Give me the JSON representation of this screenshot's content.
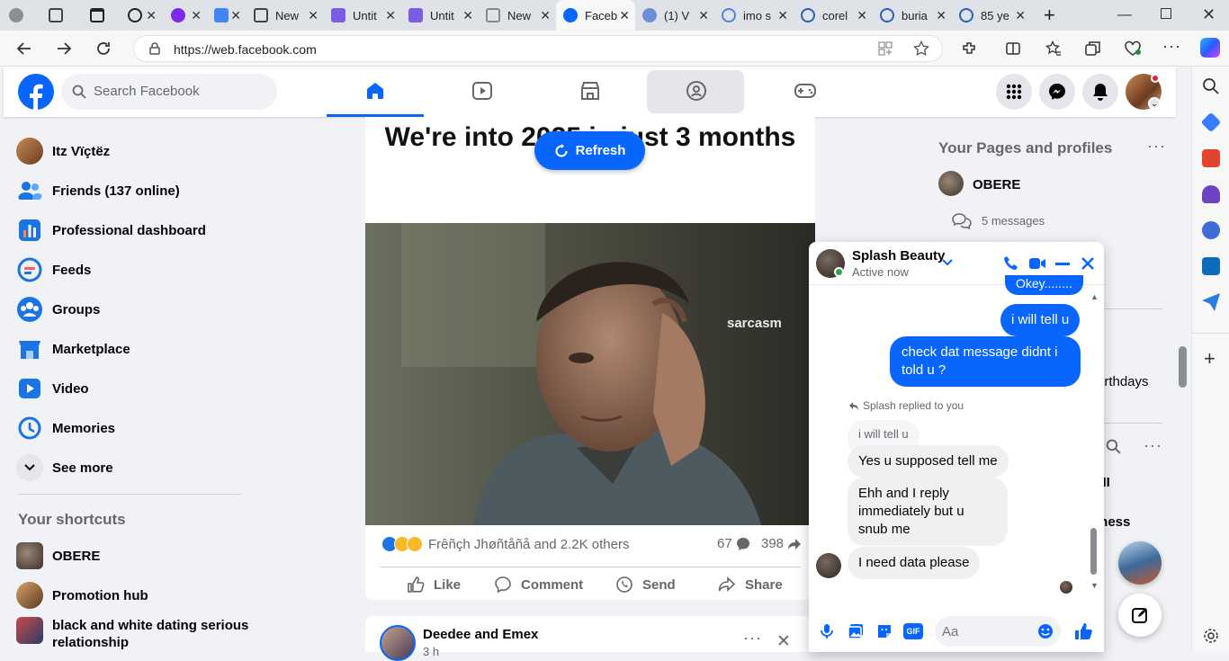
{
  "browser": {
    "tabs": [
      {
        "title": "",
        "favicon": "profile-icon",
        "color": "#888888"
      },
      {
        "title": "",
        "favicon": "collections-icon",
        "color": "#555555"
      },
      {
        "title": "",
        "favicon": "tab-actions-icon",
        "color": "#333333"
      },
      {
        "title": "",
        "favicon": "chatgpt-icon",
        "color": "#222222"
      },
      {
        "title": "",
        "favicon": "canva-icon",
        "color": "#7d2ae8"
      },
      {
        "title": "",
        "favicon": "translate-icon",
        "color": "#4285f4"
      },
      {
        "title": "New",
        "favicon": "newtab-icon",
        "color": "#444444"
      },
      {
        "title": "Untit",
        "favicon": "doc-icon",
        "color": "#7b5ce5"
      },
      {
        "title": "Untit",
        "favicon": "doc-icon",
        "color": "#7b5ce5"
      },
      {
        "title": "New",
        "favicon": "newtab-icon",
        "color": "#888888"
      },
      {
        "title": "Faceb",
        "favicon": "facebook-icon",
        "color": "#0866ff",
        "active": true
      },
      {
        "title": "(1) V",
        "favicon": "facebook-icon",
        "color": "#6b8fd6"
      },
      {
        "title": "imo s",
        "favicon": "search-icon",
        "color": "#4e84d9"
      },
      {
        "title": "corel",
        "favicon": "search-icon",
        "color": "#2c5fb8"
      },
      {
        "title": "buria",
        "favicon": "search-icon",
        "color": "#2c5fb8"
      },
      {
        "title": "85 ye",
        "favicon": "search-icon",
        "color": "#2c5fb8"
      }
    ],
    "url": "https://web.facebook.com"
  },
  "header": {
    "search_placeholder": "Search Facebook"
  },
  "left": {
    "items": [
      {
        "label": "Itz Vïçtëz",
        "icon": "avatar"
      },
      {
        "label": "Friends (137 online)",
        "icon": "friends-icon"
      },
      {
        "label": "Professional dashboard",
        "icon": "dashboard-icon"
      },
      {
        "label": "Feeds",
        "icon": "feeds-icon"
      },
      {
        "label": "Groups",
        "icon": "groups-icon"
      },
      {
        "label": "Marketplace",
        "icon": "marketplace-icon"
      },
      {
        "label": "Video",
        "icon": "video-icon"
      },
      {
        "label": "Memories",
        "icon": "memories-icon"
      },
      {
        "label": "See more",
        "icon": "chevron-down-icon"
      }
    ],
    "shortcuts_title": "Your shortcuts",
    "shortcuts": [
      {
        "label": "OBERE"
      },
      {
        "label": "Promotion hub"
      },
      {
        "label": "black and white dating serious relationship"
      }
    ]
  },
  "post": {
    "meme_text": "We're into 2025 in just 3 months",
    "refresh_label": "Refresh",
    "watermark": "sarcasm",
    "reactions_text": "Frêñçh Jhøñtåñå and 2.2K others",
    "comments_count": "67",
    "shares_count": "398",
    "actions": {
      "like": "Like",
      "comment": "Comment",
      "send": "Send",
      "share": "Share"
    }
  },
  "post2": {
    "author": "Deedee and Emex",
    "time": "3 h"
  },
  "right": {
    "pages_title": "Your Pages and profiles",
    "page_name": "OBERE",
    "messages": "5 messages",
    "birthdays_partial": "irthdays",
    "partial_1": "s II",
    "partial_2": "dness"
  },
  "chat": {
    "name": "Splash Beauty",
    "status": "Active now",
    "messages": [
      {
        "from": "me",
        "text": "Okey........"
      },
      {
        "from": "me",
        "text": "i will tell u"
      },
      {
        "from": "me",
        "text": "check dat message didnt i told u ?"
      },
      {
        "from": "them",
        "text": "Yes u supposed tell me"
      },
      {
        "from": "them",
        "text": "Ehh and I reply immediately but u snub me"
      },
      {
        "from": "them",
        "text": "I need data please"
      }
    ],
    "reply_note": "Splash replied to you",
    "quoted": "i will tell u",
    "input_placeholder": "Aa"
  },
  "colors": {
    "brand": "#0866ff",
    "bg": "#f0f2f5"
  }
}
